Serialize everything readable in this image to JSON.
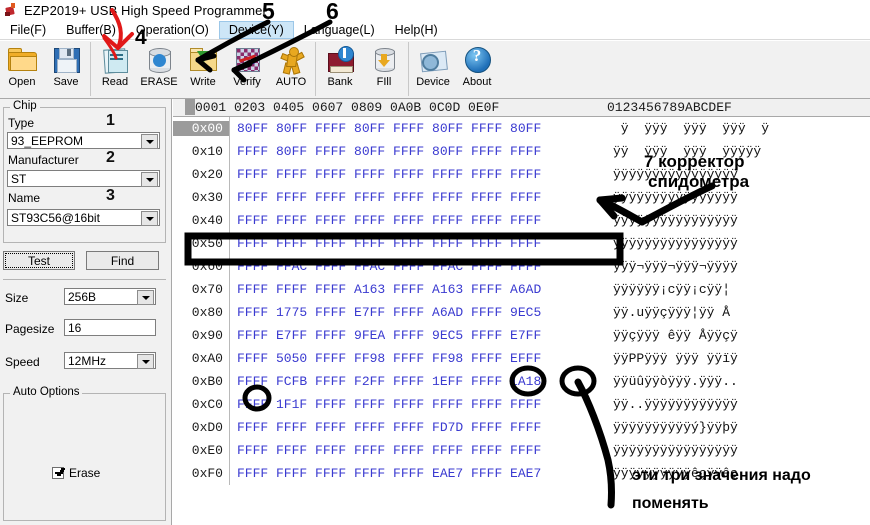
{
  "window": {
    "title": "EZP2019+ USB High Speed Programmer",
    "icon": "app-icon"
  },
  "menu": {
    "items": [
      {
        "label": "File(F)",
        "selected": false
      },
      {
        "label": "Buffer(B)",
        "selected": false
      },
      {
        "label": "Operation(O)",
        "selected": false
      },
      {
        "label": "Device(Y)",
        "selected": true
      },
      {
        "label": "Language(L)",
        "selected": false
      },
      {
        "label": "Help(H)",
        "selected": false
      }
    ]
  },
  "toolbar": {
    "buttons": [
      {
        "label": "Open",
        "icon": "open-folder-icon"
      },
      {
        "label": "Save",
        "icon": "floppy-disk-icon"
      },
      {
        "label": "Read",
        "icon": "notepad-read-icon"
      },
      {
        "label": "ERASE",
        "icon": "erase-cylinder-icon"
      },
      {
        "label": "Write",
        "icon": "write-folder-arrow-icon"
      },
      {
        "label": "Verify",
        "icon": "verify-checker-icon"
      },
      {
        "label": "AUTO",
        "icon": "auto-runner-icon"
      },
      {
        "label": "Bank",
        "icon": "bank-book-icon"
      },
      {
        "label": "FIll",
        "icon": "fill-cylinder-icon"
      },
      {
        "label": "Device",
        "icon": "device-gear-folder-icon"
      },
      {
        "label": "About",
        "icon": "about-question-icon"
      }
    ]
  },
  "sidebar": {
    "chip_group_caption": "Chip",
    "type_label": "Type",
    "type_value": "93_EEPROM",
    "manufacturer_label": "Manufacturer",
    "manufacturer_value": "ST",
    "name_label": "Name",
    "name_value": "ST93C56@16bit",
    "test_button": "Test",
    "find_button": "Find",
    "size_label": "Size",
    "size_value": "256B",
    "pagesize_label": "Pagesize",
    "pagesize_value": "16",
    "speed_label": "Speed",
    "speed_value": "12MHz",
    "auto_options_caption": "Auto Options",
    "erase_checkbox_label": "Erase",
    "erase_checked": true
  },
  "hex": {
    "column_header": "0001 0203 0405 0607 0809 0A0B 0C0D 0E0F",
    "ascii_header": "0123456789ABCDEF",
    "rows": [
      {
        "addr": "0x00",
        "selected": true,
        "bytes": "80FF 80FF FFFF 80FF FFFF 80FF FFFF 80FF",
        "ascii": " ÿ  ÿÿÿ  ÿÿÿ  ÿÿÿ  ÿ"
      },
      {
        "addr": "0x10",
        "selected": false,
        "bytes": "FFFF 80FF FFFF 80FF FFFF 80FF FFFF FFFF",
        "ascii": "ÿÿ  ÿÿÿ  ÿÿÿ  ÿÿÿÿÿ"
      },
      {
        "addr": "0x20",
        "selected": false,
        "bytes": "FFFF FFFF FFFF FFFF FFFF FFFF FFFF FFFF",
        "ascii": "ÿÿÿÿÿÿÿÿÿÿÿÿÿÿÿÿ"
      },
      {
        "addr": "0x30",
        "selected": false,
        "bytes": "FFFF FFFF FFFF FFFF FFFF FFFF FFFF FFFF",
        "ascii": "ÿÿÿÿÿÿÿÿÿÿÿÿÿÿÿÿ"
      },
      {
        "addr": "0x40",
        "selected": false,
        "bytes": "FFFF FFFF FFFF FFFF FFFF FFFF FFFF FFFF",
        "ascii": "ÿÿÿÿÿÿÿÿÿÿÿÿÿÿÿÿ"
      },
      {
        "addr": "0x50",
        "selected": false,
        "bytes": "FFFF FFFF FFFF FFFF FFFF FFFF FFFF FFFF",
        "ascii": "ÿÿÿÿÿÿÿÿÿÿÿÿÿÿÿÿ"
      },
      {
        "addr": "0x60",
        "selected": false,
        "bytes": "FFFF FFAC FFFF FFAC FFFF FFAC FFFF FFFF",
        "ascii": "ÿÿÿ¬ÿÿÿ¬ÿÿÿ¬ÿÿÿÿ"
      },
      {
        "addr": "0x70",
        "selected": false,
        "bytes": "FFFF FFFF FFFF A163 FFFF A163 FFFF A6AD",
        "ascii": "ÿÿÿÿÿÿ¡cÿÿ¡cÿÿ¦­"
      },
      {
        "addr": "0x80",
        "selected": false,
        "bytes": "FFFF 1775 FFFF E7FF FFFF A6AD FFFF 9EC5",
        "ascii": "ÿÿ.uÿÿçÿÿÿ¦­ÿÿ Å"
      },
      {
        "addr": "0x90",
        "selected": false,
        "bytes": "FFFF E7FF FFFF 9FEA FFFF 9EC5 FFFF E7FF",
        "ascii": "ÿÿçÿÿÿ êÿÿ Åÿÿçÿ"
      },
      {
        "addr": "0xA0",
        "selected": false,
        "bytes": "FFFF 5050 FFFF FF98 FFFF FF98 FFFF EFFF",
        "ascii": "ÿÿPPÿÿÿ ÿÿÿ ÿÿïÿ"
      },
      {
        "addr": "0xB0",
        "selected": false,
        "bytes": "FFFF FCFB FFFF F2FF FFFF 1EFF FFFF 1A18",
        "ascii": "ÿÿüûÿÿòÿÿÿ.ÿÿÿ.."
      },
      {
        "addr": "0xC0",
        "selected": false,
        "bytes": "FFFF 1F1F FFFF FFFF FFFF FFFF FFFF FFFF",
        "ascii": "ÿÿ..ÿÿÿÿÿÿÿÿÿÿÿÿ"
      },
      {
        "addr": "0xD0",
        "selected": false,
        "bytes": "FFFF FFFF FFFF FFFF FFFF FD7D FFFF FFFF",
        "ascii": "ÿÿÿÿÿÿÿÿÿÿý}ÿÿþÿ"
      },
      {
        "addr": "0xE0",
        "selected": false,
        "bytes": "FFFF FFFF FFFF FFFF FFFF FFFF FFFF FFFF",
        "ascii": "ÿÿÿÿÿÿÿÿÿÿÿÿÿÿÿÿ"
      },
      {
        "addr": "0xF0",
        "selected": false,
        "bytes": "FFFF FFFF FFFF FFFF FFFF EAE7 FFFF EAE7",
        "ascii": "ÿÿÿÿÿÿÿÿÿÿêçÿÿêç"
      }
    ]
  },
  "annotations": {
    "markers": [
      {
        "id": "1",
        "text": "1"
      },
      {
        "id": "2",
        "text": "2"
      },
      {
        "id": "3",
        "text": "3"
      },
      {
        "id": "4",
        "text": "4"
      },
      {
        "id": "5",
        "text": "5"
      },
      {
        "id": "6",
        "text": "6"
      }
    ],
    "note_top_line1": "7 корректор",
    "note_top_line2": "спидометра",
    "note_bottom_line1": "эти три значения надо",
    "note_bottom_line2": "поменять"
  },
  "colors": {
    "hex_value": "#3a3ad0",
    "menu_selected_bg": "#cde6f7",
    "toolbar_bg": "#f1f1f1",
    "annotation_red": "#e11818",
    "annotation_black": "#000000",
    "row_highlight": "#9b9b9b"
  }
}
